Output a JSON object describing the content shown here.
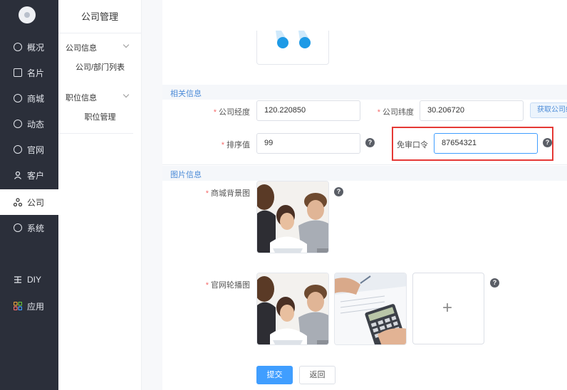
{
  "nav": {
    "items": [
      {
        "label": "概况",
        "icon": "pie-chart-icon"
      },
      {
        "label": "名片",
        "icon": "card-icon"
      },
      {
        "label": "商城",
        "icon": "shop-icon"
      },
      {
        "label": "动态",
        "icon": "compass-icon"
      },
      {
        "label": "官网",
        "icon": "globe-icon"
      },
      {
        "label": "客户",
        "icon": "user-icon"
      },
      {
        "label": "公司",
        "icon": "org-icon"
      },
      {
        "label": "系统",
        "icon": "gear-icon"
      },
      {
        "label": "DIY",
        "icon": "diy-icon"
      },
      {
        "label": "应用",
        "icon": "apps-icon"
      }
    ],
    "active": "公司"
  },
  "submenu": {
    "title": "公司管理",
    "groups": [
      {
        "label": "公司信息",
        "links": [
          "公司/部门列表"
        ]
      },
      {
        "label": "职位信息",
        "links": [
          "职位管理"
        ]
      }
    ]
  },
  "form": {
    "related_section": "相关信息",
    "longitude_label": "公司经度",
    "longitude_value": "120.220850",
    "latitude_label": "公司纬度",
    "latitude_value": "30.206720",
    "locate_button": "获取公司经纬度",
    "sort_label": "排序值",
    "sort_value": "99",
    "passcode_label": "免审口令",
    "passcode_value": "87654321",
    "image_section": "图片信息",
    "mall_bg_label": "商城背景图",
    "carousel_label": "官网轮播图",
    "submit_label": "提交",
    "back_label": "返回"
  },
  "colors": {
    "nav_bg": "#2b2f3a",
    "primary": "#409eff",
    "highlight": "#e53935",
    "required": "#f56c6c"
  }
}
